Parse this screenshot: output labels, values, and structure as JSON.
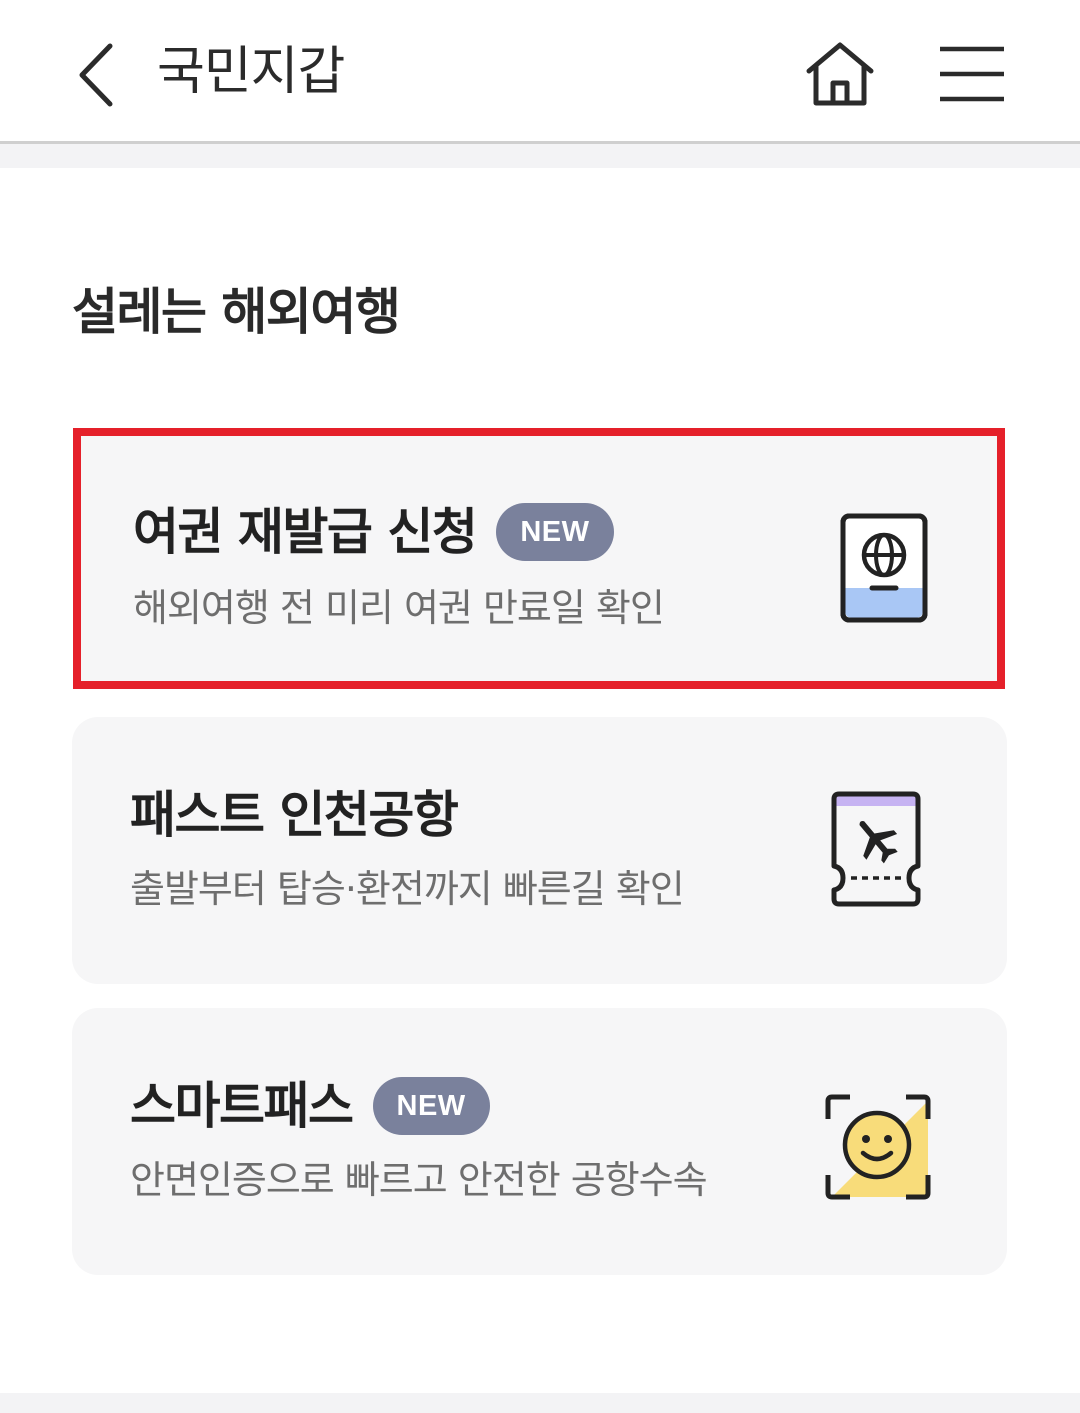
{
  "header": {
    "back_icon": "chevron-left-icon",
    "title": "국민지갑",
    "home_icon": "home-icon",
    "menu_icon": "hamburger-menu-icon"
  },
  "section": {
    "title": "설레는 해외여행"
  },
  "cards": [
    {
      "title": "여권 재발급 신청",
      "badge": "NEW",
      "description": "해외여행 전 미리 여권 만료일 확인",
      "icon": "passport-icon",
      "highlighted": true
    },
    {
      "title": "패스트 인천공항",
      "badge": "",
      "description": "출발부터 탑승·환전까지 빠른길 확인",
      "icon": "boarding-ticket-icon",
      "highlighted": false
    },
    {
      "title": "스마트패스",
      "badge": "NEW",
      "description": "안면인증으로 빠르고 안전한 공항수속",
      "icon": "face-scan-icon",
      "highlighted": false
    }
  ],
  "colors": {
    "highlight_border": "#e5202a",
    "badge_bg": "#7a819c",
    "card_bg": "#f6f6f7",
    "passport_accent": "#a9c7f5",
    "ticket_accent": "#c6b3f2",
    "face_accent": "#f8dc7a"
  }
}
